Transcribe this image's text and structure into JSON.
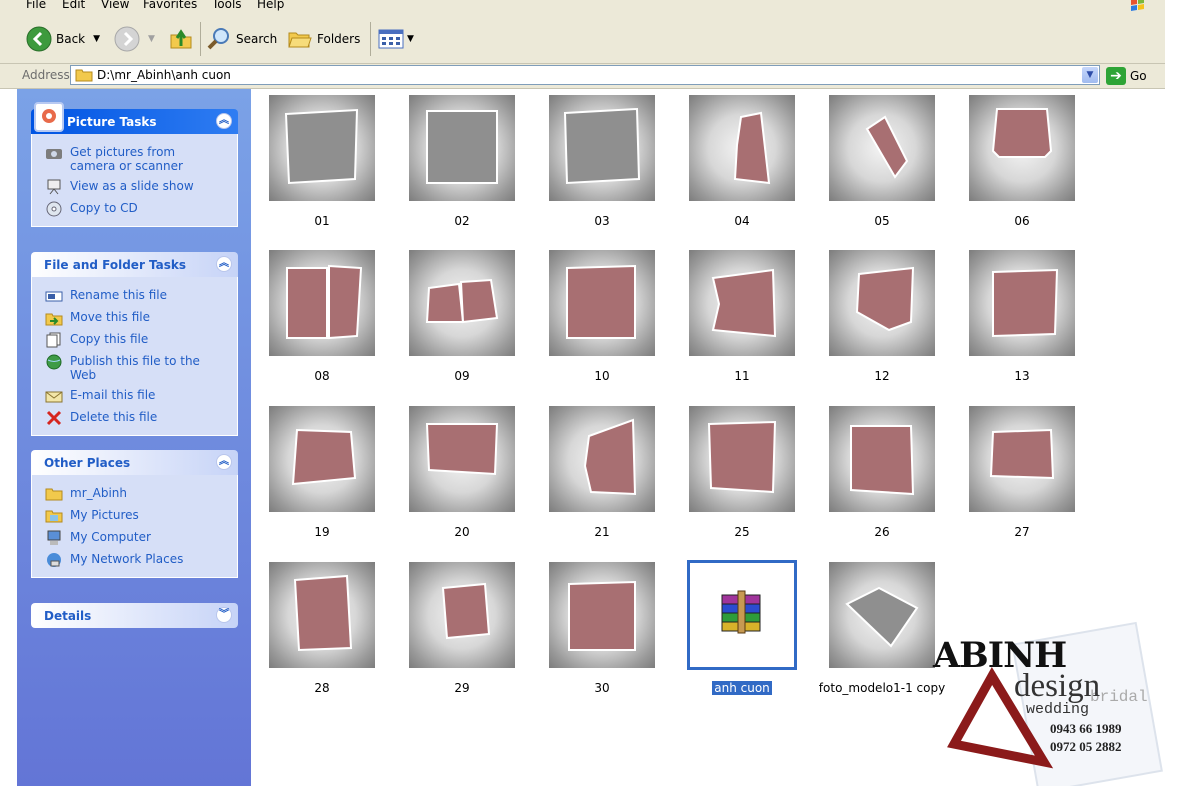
{
  "menu": [
    "File",
    "Edit",
    "View",
    "Favorites",
    "Tools",
    "Help"
  ],
  "toolbar": {
    "back": "Back",
    "search": "Search",
    "folders": "Folders"
  },
  "address": {
    "label": "Address",
    "path": "D:\\mr_Abinh\\anh cuon",
    "go": "Go"
  },
  "panels": {
    "picture_tasks": {
      "title": "Picture Tasks",
      "items": [
        "Get pictures from camera or scanner",
        "View as a slide show",
        "Copy to CD"
      ]
    },
    "file_folder_tasks": {
      "title": "File and Folder Tasks",
      "items": [
        "Rename this file",
        "Move this file",
        "Copy this file",
        "Publish this file to the Web",
        "E-mail this file",
        "Delete this file"
      ]
    },
    "other_places": {
      "title": "Other Places",
      "items": [
        "mr_Abinh",
        "My Pictures",
        "My Computer",
        "My Network Places"
      ]
    },
    "details": {
      "title": "Details"
    }
  },
  "files": [
    {
      "name": "01",
      "kind": "thumb"
    },
    {
      "name": "02",
      "kind": "thumb"
    },
    {
      "name": "03",
      "kind": "thumb"
    },
    {
      "name": "04",
      "kind": "thumb"
    },
    {
      "name": "05",
      "kind": "thumb"
    },
    {
      "name": "06",
      "kind": "thumb"
    },
    {
      "name": "08",
      "kind": "thumb"
    },
    {
      "name": "09",
      "kind": "thumb"
    },
    {
      "name": "10",
      "kind": "thumb"
    },
    {
      "name": "11",
      "kind": "thumb"
    },
    {
      "name": "12",
      "kind": "thumb"
    },
    {
      "name": "13",
      "kind": "thumb"
    },
    {
      "name": "19",
      "kind": "thumb"
    },
    {
      "name": "20",
      "kind": "thumb"
    },
    {
      "name": "21",
      "kind": "thumb"
    },
    {
      "name": "25",
      "kind": "thumb"
    },
    {
      "name": "26",
      "kind": "thumb"
    },
    {
      "name": "27",
      "kind": "thumb"
    },
    {
      "name": "28",
      "kind": "thumb"
    },
    {
      "name": "29",
      "kind": "thumb"
    },
    {
      "name": "30",
      "kind": "thumb"
    },
    {
      "name": "anh cuon",
      "kind": "archive",
      "selected": true
    },
    {
      "name": "foto_modelo1-1 copy",
      "kind": "thumb"
    }
  ],
  "watermark": {
    "brand": "ABINH",
    "design": "design",
    "bridal": "bridal",
    "wedding": "wedding",
    "phone1": "0943 66 1989",
    "phone2": "0972 05 2882"
  },
  "colors": {
    "photo": "#a86f72",
    "frame": "#ffffff",
    "selection": "#316ac5",
    "triangle": "#8b1a1a"
  }
}
